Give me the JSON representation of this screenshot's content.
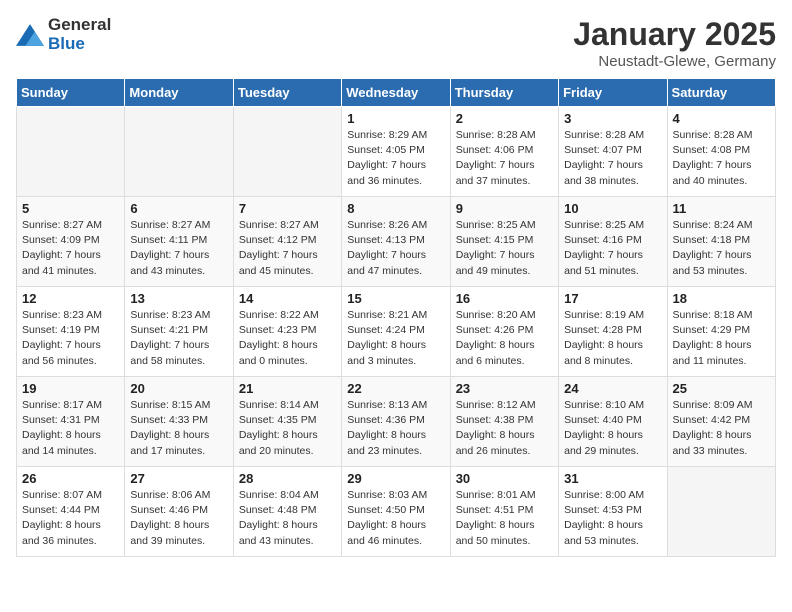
{
  "header": {
    "logo_general": "General",
    "logo_blue": "Blue",
    "title": "January 2025",
    "subtitle": "Neustadt-Glewe, Germany"
  },
  "weekdays": [
    "Sunday",
    "Monday",
    "Tuesday",
    "Wednesday",
    "Thursday",
    "Friday",
    "Saturday"
  ],
  "weeks": [
    [
      {
        "day": "",
        "info": ""
      },
      {
        "day": "",
        "info": ""
      },
      {
        "day": "",
        "info": ""
      },
      {
        "day": "1",
        "info": "Sunrise: 8:29 AM\nSunset: 4:05 PM\nDaylight: 7 hours\nand 36 minutes."
      },
      {
        "day": "2",
        "info": "Sunrise: 8:28 AM\nSunset: 4:06 PM\nDaylight: 7 hours\nand 37 minutes."
      },
      {
        "day": "3",
        "info": "Sunrise: 8:28 AM\nSunset: 4:07 PM\nDaylight: 7 hours\nand 38 minutes."
      },
      {
        "day": "4",
        "info": "Sunrise: 8:28 AM\nSunset: 4:08 PM\nDaylight: 7 hours\nand 40 minutes."
      }
    ],
    [
      {
        "day": "5",
        "info": "Sunrise: 8:27 AM\nSunset: 4:09 PM\nDaylight: 7 hours\nand 41 minutes."
      },
      {
        "day": "6",
        "info": "Sunrise: 8:27 AM\nSunset: 4:11 PM\nDaylight: 7 hours\nand 43 minutes."
      },
      {
        "day": "7",
        "info": "Sunrise: 8:27 AM\nSunset: 4:12 PM\nDaylight: 7 hours\nand 45 minutes."
      },
      {
        "day": "8",
        "info": "Sunrise: 8:26 AM\nSunset: 4:13 PM\nDaylight: 7 hours\nand 47 minutes."
      },
      {
        "day": "9",
        "info": "Sunrise: 8:25 AM\nSunset: 4:15 PM\nDaylight: 7 hours\nand 49 minutes."
      },
      {
        "day": "10",
        "info": "Sunrise: 8:25 AM\nSunset: 4:16 PM\nDaylight: 7 hours\nand 51 minutes."
      },
      {
        "day": "11",
        "info": "Sunrise: 8:24 AM\nSunset: 4:18 PM\nDaylight: 7 hours\nand 53 minutes."
      }
    ],
    [
      {
        "day": "12",
        "info": "Sunrise: 8:23 AM\nSunset: 4:19 PM\nDaylight: 7 hours\nand 56 minutes."
      },
      {
        "day": "13",
        "info": "Sunrise: 8:23 AM\nSunset: 4:21 PM\nDaylight: 7 hours\nand 58 minutes."
      },
      {
        "day": "14",
        "info": "Sunrise: 8:22 AM\nSunset: 4:23 PM\nDaylight: 8 hours\nand 0 minutes."
      },
      {
        "day": "15",
        "info": "Sunrise: 8:21 AM\nSunset: 4:24 PM\nDaylight: 8 hours\nand 3 minutes."
      },
      {
        "day": "16",
        "info": "Sunrise: 8:20 AM\nSunset: 4:26 PM\nDaylight: 8 hours\nand 6 minutes."
      },
      {
        "day": "17",
        "info": "Sunrise: 8:19 AM\nSunset: 4:28 PM\nDaylight: 8 hours\nand 8 minutes."
      },
      {
        "day": "18",
        "info": "Sunrise: 8:18 AM\nSunset: 4:29 PM\nDaylight: 8 hours\nand 11 minutes."
      }
    ],
    [
      {
        "day": "19",
        "info": "Sunrise: 8:17 AM\nSunset: 4:31 PM\nDaylight: 8 hours\nand 14 minutes."
      },
      {
        "day": "20",
        "info": "Sunrise: 8:15 AM\nSunset: 4:33 PM\nDaylight: 8 hours\nand 17 minutes."
      },
      {
        "day": "21",
        "info": "Sunrise: 8:14 AM\nSunset: 4:35 PM\nDaylight: 8 hours\nand 20 minutes."
      },
      {
        "day": "22",
        "info": "Sunrise: 8:13 AM\nSunset: 4:36 PM\nDaylight: 8 hours\nand 23 minutes."
      },
      {
        "day": "23",
        "info": "Sunrise: 8:12 AM\nSunset: 4:38 PM\nDaylight: 8 hours\nand 26 minutes."
      },
      {
        "day": "24",
        "info": "Sunrise: 8:10 AM\nSunset: 4:40 PM\nDaylight: 8 hours\nand 29 minutes."
      },
      {
        "day": "25",
        "info": "Sunrise: 8:09 AM\nSunset: 4:42 PM\nDaylight: 8 hours\nand 33 minutes."
      }
    ],
    [
      {
        "day": "26",
        "info": "Sunrise: 8:07 AM\nSunset: 4:44 PM\nDaylight: 8 hours\nand 36 minutes."
      },
      {
        "day": "27",
        "info": "Sunrise: 8:06 AM\nSunset: 4:46 PM\nDaylight: 8 hours\nand 39 minutes."
      },
      {
        "day": "28",
        "info": "Sunrise: 8:04 AM\nSunset: 4:48 PM\nDaylight: 8 hours\nand 43 minutes."
      },
      {
        "day": "29",
        "info": "Sunrise: 8:03 AM\nSunset: 4:50 PM\nDaylight: 8 hours\nand 46 minutes."
      },
      {
        "day": "30",
        "info": "Sunrise: 8:01 AM\nSunset: 4:51 PM\nDaylight: 8 hours\nand 50 minutes."
      },
      {
        "day": "31",
        "info": "Sunrise: 8:00 AM\nSunset: 4:53 PM\nDaylight: 8 hours\nand 53 minutes."
      },
      {
        "day": "",
        "info": ""
      }
    ]
  ]
}
